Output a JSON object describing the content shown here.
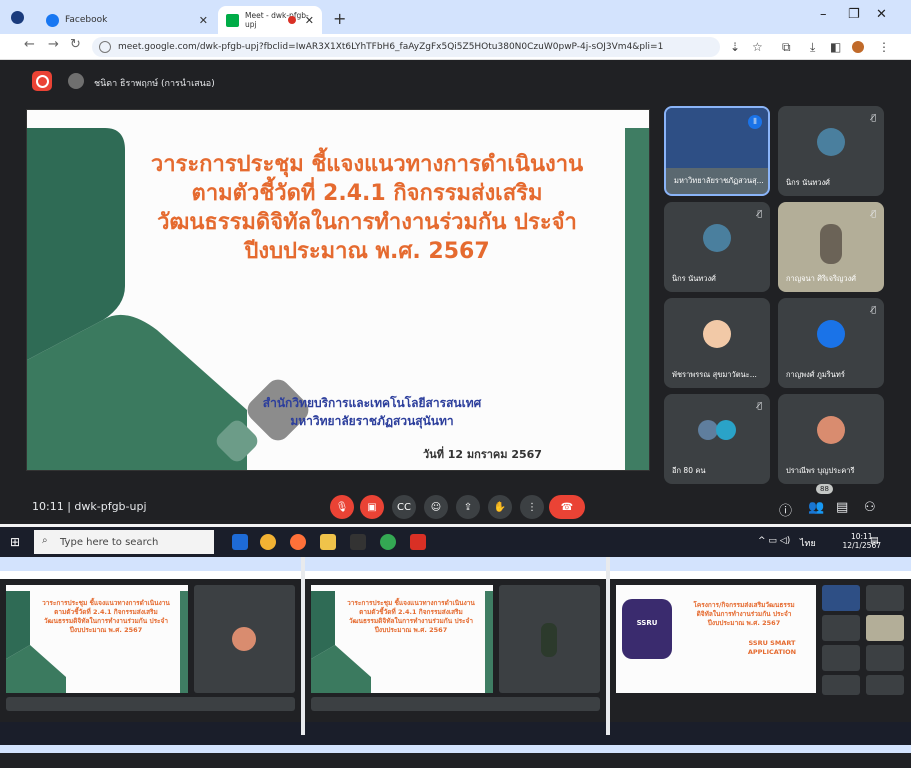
{
  "browser": {
    "tabs": [
      {
        "title": "Facebook",
        "active": false
      },
      {
        "title": "Meet - dwk-pfgb-upj",
        "active": true
      }
    ],
    "url": "meet.google.com/dwk-pfgb-upj?fbclid=IwAR3X1Xt6LYhTFbH6_faAyZgFx5Qi5Z5HOtu380N0CzuW0pwP-4j-sOJ3Vm4&pli=1"
  },
  "meet": {
    "presenter_name": "ชนิดา ธิราพฤกษ์ (การนำเสนอ)",
    "meeting_code": "10:11  |  dwk-pfgb-upj",
    "participants_badge": "88",
    "slide": {
      "title_lines": [
        "วาระการประชุม ชี้แจงแนวทางการดำเนินงาน",
        "ตามตัวชี้วัดที่ 2.4.1 กิจกรรมส่งเสริม",
        "วัฒนธรรมดิจิทัลในการทำงานร่วมกัน ประจำ",
        "ปีงบประมาณ พ.ศ. 2567"
      ],
      "org_lines": [
        "สำนักวิทยบริการและเทคโนโลยีสารสนเทศ",
        "มหาวิทยาลัยราชภัฏสวนสุนันทา"
      ],
      "date": "วันที่ 12 มกราคม 2567"
    },
    "participants": [
      {
        "name": "มหาวิทยาลัยราชภัฏสวนสุ...",
        "muted": false,
        "speaking": true
      },
      {
        "name": "นิกร นันทวงศ์",
        "muted": true
      },
      {
        "name": "นิกร นันทวงศ์",
        "muted": true
      },
      {
        "name": "กาญจนา ศิริเจริญวงศ์",
        "muted": true
      },
      {
        "name": "พัชราพรรณ สุขมาวัตนะ...",
        "muted": false
      },
      {
        "name": "กาญพงศ์ ภูมรินทร์",
        "muted": true
      },
      {
        "name": "อีก 80 คน",
        "muted": true
      },
      {
        "name": "ปราณีพร บุญประคารี",
        "muted": false
      }
    ],
    "controls": [
      "mic-off",
      "cam-off",
      "captions",
      "emoji",
      "present",
      "raise-hand",
      "more",
      "end-call"
    ],
    "colors": {
      "accent": "#ea4335",
      "bg": "#202124",
      "tile": "#3c4043",
      "title": "#e56a2f",
      "org": "#2c3e9c",
      "green": "#2f6b55"
    }
  },
  "taskbar": {
    "search_placeholder": "Type here to search",
    "time": "10:11",
    "date": "12/1/2567",
    "lang": "ไทย"
  },
  "collage": {
    "screens": [
      {
        "title_lines": [
          "วาระการประชุม ชี้แจงแนวทางการดำเนินงาน",
          "ตามตัวชี้วัดที่ 2.4.1 กิจกรรมส่งเสริม",
          "วัฒนธรรมดิจิทัลในการทำงานร่วมกัน ประจำ",
          "ปีงบประมาณ พ.ศ. 2567"
        ]
      },
      {
        "title_lines": [
          "วาระการประชุม ชี้แจงแนวทางการดำเนินงาน",
          "ตามตัวชี้วัดที่ 2.4.1 กิจกรรมส่งเสริม",
          "วัฒนธรรมดิจิทัลในการทำงานร่วมกัน ประจำ",
          "ปีงบประมาณ พ.ศ. 2567"
        ]
      },
      {
        "title_lines": [
          "โครงการ/กิจกรรมส่งเสริมวัฒนธรรม",
          "ดิจิทัลในการทำงานร่วมกัน ประจำ",
          "ปีงบประมาณ พ.ศ. 2567"
        ],
        "brand": "SSRU SMART APPLICATION",
        "badge": "SSRU"
      }
    ]
  }
}
